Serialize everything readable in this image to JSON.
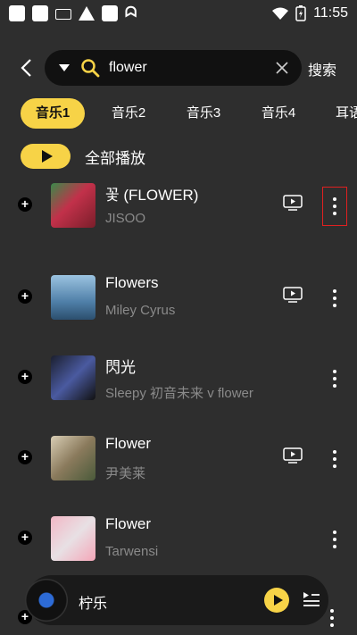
{
  "status_bar": {
    "time": "11:55"
  },
  "search": {
    "value": "flower",
    "submit_label": "搜索"
  },
  "tabs": [
    "音乐1",
    "音乐2",
    "音乐3",
    "音乐4",
    "耳语"
  ],
  "play_all_label": "全部播放",
  "songs": [
    {
      "title": "꽃 (FLOWER)",
      "artist": "JISOO",
      "has_mv": true
    },
    {
      "title": "Flowers",
      "artist": "Miley Cyrus",
      "has_mv": true
    },
    {
      "title": "閃光",
      "artist": "Sleepy 初音未来 v flower",
      "has_mv": false
    },
    {
      "title": "Flower",
      "artist": "尹美莱",
      "has_mv": true
    },
    {
      "title": "Flower",
      "artist": "Tarwensi",
      "has_mv": false
    }
  ],
  "player": {
    "title": "柠乐"
  },
  "colors": {
    "accent": "#f7d347",
    "background": "#2e2e2e",
    "highlight_box": "#e02020"
  }
}
